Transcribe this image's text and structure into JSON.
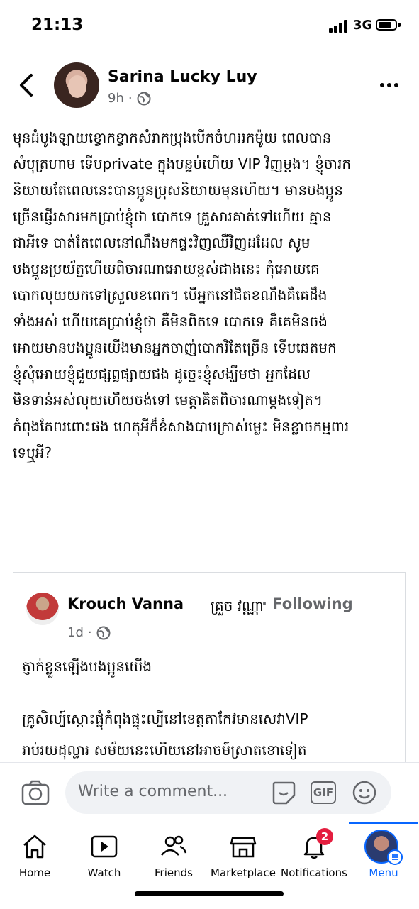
{
  "status_bar": {
    "time": "21:13",
    "network": "3G"
  },
  "post": {
    "author": "Sarina Lucky Luy",
    "time": "9h",
    "dot": "·",
    "text": "មុនដំបូងឡាយខ្វោកខ្វាកសំរាកប្រុងបើកចំហររកម៉ូយ ពេលបាន\nសំបុត្រហាម ទើបprivate ក្នុងបន្ទប់ហើយ VIP វិញម្តង។ ខ្ញុំចារក\nនិយាយតែពេលនេះបានប្អូនប្រុសនិយាយមុនហើយ។ មានបងប្អូន\nច្រើនផ្ញើរសារមកប្រាប់ខ្ញុំថា បោកទេ គ្រួសារគាត់ទៅហើយ គ្មាន\nជាអីទេ បាត់តែពេលនៅណឹងមកផ្ទះវិញឈឺវិញដដែល សូម\nបងប្អូនប្រយ័ត្នហើយពិចារណាអោយខ្ពស់ជាងនេះ កុំអោយគេ\nបោកលុយយកទៅស្រួលខពេក។ បើអ្នកនៅជិតខណឹងគឺគេដឹង\nទាំងអស់ ហើយគេប្រាប់ខ្ញុំថា គឺមិនពិតទេ បោកទេ គឺគេមិនចង់\nអោយមានបងប្អូនយើងមានអ្នកចាញ់បោកវិតែច្រើន ទើបឆេតមក\nខ្ញុំសុំអោយខ្ញុំជួយផ្សព្វផ្សាយផង ដូច្នេះខ្ញុំសង្ឃឹមថា អ្នកដែល\nមិនទាន់អស់លុយហើយចង់ទៅ មេត្តាគិតពិចារណាម្តងទៀត។\nកំពុងតែពរពោះផង ហេតុអីក៏ខំសាងបាបក្រាស់ម្លេះ មិនខ្លាចកម្មពារ\nទេឬអី?"
  },
  "shared": {
    "author": "Krouch Vanna",
    "author_khmer": "គ្រួច វណ្ណា",
    "following": "· Following",
    "time": "1d",
    "dot": "·",
    "line1": "ភ្ញាក់ខ្លួនឡើងបងប្អូនយើង",
    "line2": "គ្រូសិល្ប៍ស្តោះផ្លុំកំពុងផ្ទុះល្បីនៅខេត្តតាកែវមានសេវាVIP",
    "line3": "រាប់រយដុល្លារ សម័យនេះហើយនៅអាចម៍ស្រាតខោទៀត"
  },
  "composer": {
    "placeholder": "Write a comment...",
    "gif_label": "GIF"
  },
  "tabs": [
    {
      "label": "Home",
      "icon": "home-icon"
    },
    {
      "label": "Watch",
      "icon": "watch-icon"
    },
    {
      "label": "Friends",
      "icon": "friends-icon"
    },
    {
      "label": "Marketplace",
      "icon": "marketplace-icon"
    },
    {
      "label": "Notifications",
      "icon": "bell-icon",
      "badge": "2"
    },
    {
      "label": "Menu",
      "icon": "menu-avatar",
      "active": true
    }
  ],
  "colors": {
    "accent": "#0866ff",
    "badge": "#e41e3f",
    "secondary_text": "#65676b"
  }
}
